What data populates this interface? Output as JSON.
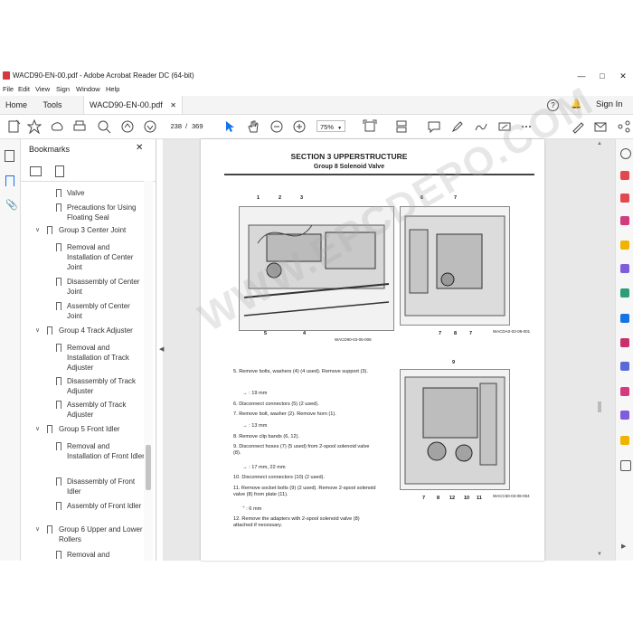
{
  "window": {
    "title": "WACD90-EN-00.pdf - Adobe Acrobat Reader DC (64-bit)"
  },
  "menu": [
    "File",
    "Edit",
    "View",
    "Sign",
    "Window",
    "Help"
  ],
  "tabs": {
    "home": "Home",
    "tools": "Tools",
    "doc": "WACD90-EN-00.pdf"
  },
  "account": {
    "signin": "Sign In"
  },
  "toolbar": {
    "page_current": "238",
    "page_sep": "/",
    "page_total": "369",
    "zoom": "75%"
  },
  "bookmarks": {
    "title": "Bookmarks",
    "items": [
      {
        "text": "Valve",
        "level": 2
      },
      {
        "text": "Precautions for Using Floating Seal",
        "level": 2
      },
      {
        "text": "Group 3 Center Joint",
        "level": 1
      },
      {
        "text": "Removal and Installation of Center Joint",
        "level": 2
      },
      {
        "text": "Disassembly of Center Joint",
        "level": 2
      },
      {
        "text": "Assembly of Center Joint",
        "level": 2
      },
      {
        "text": "Group 4 Track Adjuster",
        "level": 1
      },
      {
        "text": "Removal and Installation of Track Adjuster",
        "level": 2
      },
      {
        "text": "Disassembly of Track Adjuster",
        "level": 2
      },
      {
        "text": "Assembly of Track Adjuster",
        "level": 2
      },
      {
        "text": "Group 5 Front Idler",
        "level": 1
      },
      {
        "text": "Removal and Installation of Front Idler",
        "level": 2
      },
      {
        "text": "Disassembly of Front Idler",
        "level": 2
      },
      {
        "text": "Assembly of Front Idler",
        "level": 2
      },
      {
        "text": "Group 6 Upper and Lower Rollers",
        "level": 1
      },
      {
        "text": "Removal and",
        "level": 2
      }
    ]
  },
  "page": {
    "section": "SECTION 3 UPPERSTRUCTURE",
    "group": "Group 8 Solenoid Valve",
    "watermark": "WWW.EPCDEPO.COM",
    "fig1_id": "WACD90-03-05-006",
    "fig2_id": "WACDA0-03-08-001",
    "fig3_id": "WACC50-03-08-004",
    "steps": [
      "5.  Remove bolts, washers (4) (4 used). Remove support (3).",
      ": 19 mm",
      "6.  Disconnect connectors (5) (2 used).",
      "7.  Remove bolt, washer (2). Remove horn (1).",
      ": 13 mm",
      "8.  Remove clip bands (6, 12).",
      "9.  Disconnect hoses (7) (5 used) from 2-spool solenoid valve (8).",
      ": 17 mm, 22 mm",
      "10. Disconnect connectors (10) (2 used).",
      "11. Remove socket bolts (9) (2 used). Remove 2-spool solenoid valve (8) from plate (11).",
      ": 6 mm",
      "12. Remove the adapters with 2-spool solenoid valve (8) attached if necessary."
    ]
  },
  "colors": {
    "accent": "#1473e6",
    "titlebar_icon": "#d7373f"
  }
}
